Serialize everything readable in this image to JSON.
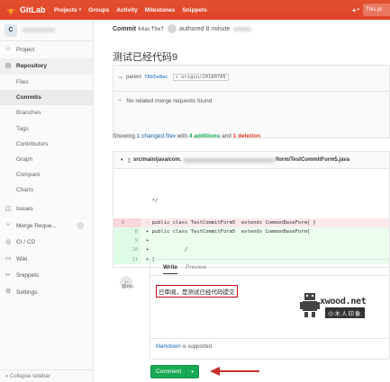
{
  "navbar": {
    "brand": "GitLab",
    "links": [
      "Projects",
      "Groups",
      "Activity",
      "Milestones",
      "Snippets"
    ],
    "plus": "+",
    "search_placeholder": "This pr"
  },
  "sidebar": {
    "avatar_letter": "C",
    "items": [
      {
        "label": "Project",
        "icon": "home-icon"
      },
      {
        "label": "Repository",
        "icon": "book-icon"
      }
    ],
    "repo_sub": [
      "Files",
      "Commits",
      "Branches",
      "Tags",
      "Contributors",
      "Graph",
      "Compare",
      "Charts"
    ],
    "items2": [
      {
        "label": "Issues",
        "icon": "issues-icon"
      },
      {
        "label": "Merge Reque...",
        "icon": "merge-request-icon"
      },
      {
        "label": "CI / CD",
        "icon": "rocket-icon"
      },
      {
        "label": "Wiki",
        "icon": "wiki-icon"
      },
      {
        "label": "Snippets",
        "icon": "snippet-icon"
      },
      {
        "label": "Settings",
        "icon": "gear-icon"
      }
    ],
    "collapse": "Collapse sidebar"
  },
  "commit": {
    "label": "Commit",
    "sha": "64acf9ef",
    "authored": "authored 8 minute",
    "title": "测试已经代码9",
    "parent_label": "parent",
    "parent_sha": "78b5a8ac",
    "branch": "origin/20180705",
    "no_mr": "No related merge requests found"
  },
  "summary": {
    "showing": "Showing",
    "changed": "1 changed file",
    "with": "with",
    "additions": "4 additions",
    "and": "and",
    "deletions": "1 deletion"
  },
  "file": {
    "path_start": "src/main/java/com.",
    "path_end": "/form/TestCommitForm5.java",
    "lines": [
      {
        "type": "ctx-faded",
        "old": "",
        "new": "",
        "code": ""
      },
      {
        "type": "ctx-faded",
        "old": "",
        "new": "",
        "code": ""
      },
      {
        "type": "ctx-faded",
        "old": "",
        "new": "",
        "code": ""
      },
      {
        "type": "ctx",
        "old": "",
        "new": "",
        "code": "  */"
      },
      {
        "type": "del",
        "old": "8",
        "new": "",
        "code": "- public class TestCommitForm5  extends CommonBaseForm{ }"
      },
      {
        "type": "add",
        "old": "",
        "new": "8",
        "code": "+ public class TestCommitForm5  extends CommonBaseForm{"
      },
      {
        "type": "add",
        "old": "",
        "new": "9",
        "code": "+"
      },
      {
        "type": "add",
        "old": "",
        "new": "10",
        "code": "+            /"
      },
      {
        "type": "add",
        "old": "",
        "new": "11",
        "code": "+ }"
      }
    ]
  },
  "comment": {
    "avatar_label": "@nju",
    "tab_write": "Write",
    "tab_preview": "Preview",
    "text": "已审阅，是测试已经代码提交",
    "md_prefix": "",
    "md_link": "Markdown",
    "md_suffix": "is supported",
    "button": "Comment"
  },
  "watermark": {
    "text": "xwood.net",
    "sub": "小木人印象"
  },
  "colors": {
    "navbar": "#e24329",
    "add": "#1aaa55",
    "del": "#db3b21",
    "link": "#1b69b6",
    "arrow": "#c9302c"
  }
}
